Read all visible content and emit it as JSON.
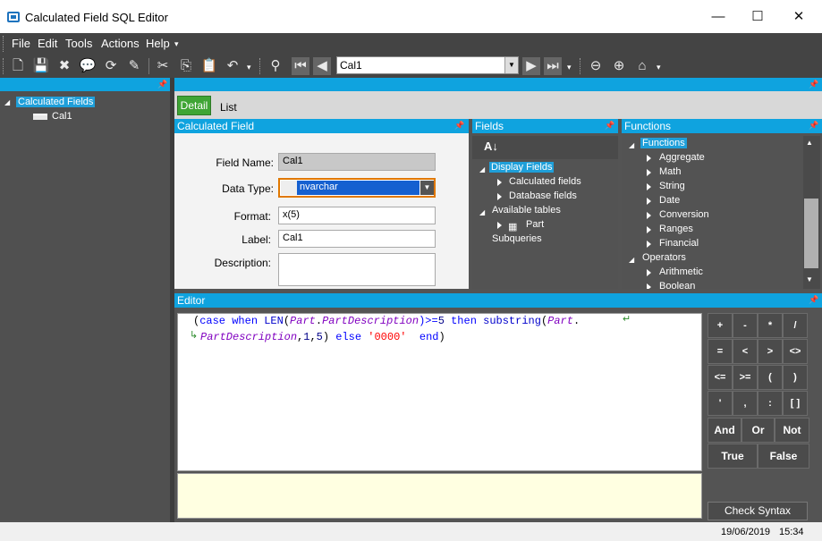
{
  "window": {
    "title": "Calculated Field SQL Editor",
    "minimize": "—",
    "maximize": "☐",
    "close": "✕"
  },
  "menu": [
    "File",
    "Edit",
    "Tools",
    "Actions",
    "Help"
  ],
  "nav": {
    "value": "Cal1"
  },
  "left_tree": {
    "root": "Calculated Fields",
    "child": "Cal1"
  },
  "tabs": {
    "detail": "Detail",
    "list": "List"
  },
  "calc_field": {
    "header": "Calculated Field",
    "labels": {
      "field_name": "Field Name:",
      "data_type": "Data Type:",
      "format": "Format:",
      "label": "Label:",
      "description": "Description:"
    },
    "values": {
      "field_name": "Cal1",
      "data_type": "nvarchar",
      "format": "x(5)",
      "label": "Cal1",
      "description": ""
    }
  },
  "fields_panel": {
    "header": "Fields",
    "items": {
      "display_fields": "Display Fields",
      "calculated_fields": "Calculated fields",
      "database_fields": "Database fields",
      "available_tables": "Available tables",
      "part": "Part",
      "subqueries": "Subqueries"
    }
  },
  "functions_panel": {
    "header": "Functions",
    "items": [
      "Functions",
      "Aggregate",
      "Math",
      "String",
      "Date",
      "Conversion",
      "Ranges",
      "Financial",
      "Operators",
      "Arithmetic",
      "Boolean"
    ]
  },
  "editor": {
    "header": "Editor",
    "line1": {
      "t1": "(",
      "t2": "case",
      "t3": "when",
      "t4": "LEN",
      "t5": "(",
      "t6": "Part",
      "t7": ".",
      "t8": "PartDescription",
      "t9": ")>=",
      "t10": "5",
      "t11": "then",
      "t12": "substring",
      "t13": "(",
      "t14": "Part",
      "t15": "."
    },
    "line2": {
      "t1": "PartDescription",
      "t2": ",",
      "t3": "1",
      "t4": ",",
      "t5": "5",
      "t6": ")",
      "t7": "else",
      "t8": "'0000'",
      "t9": "end",
      "t10": ")"
    }
  },
  "keypad": {
    "row1": [
      "+",
      "-",
      "*",
      "/"
    ],
    "row2": [
      "=",
      "<",
      ">",
      "<>"
    ],
    "row3": [
      "<=",
      ">=",
      "(",
      ")"
    ],
    "row4": [
      "'",
      ",",
      ":",
      "[ ]"
    ],
    "row5": [
      "And",
      "Or",
      "Not"
    ],
    "row6": [
      "True",
      "False"
    ],
    "check_syntax": "Check Syntax"
  },
  "status": {
    "date": "19/06/2019",
    "time": "15:34"
  }
}
